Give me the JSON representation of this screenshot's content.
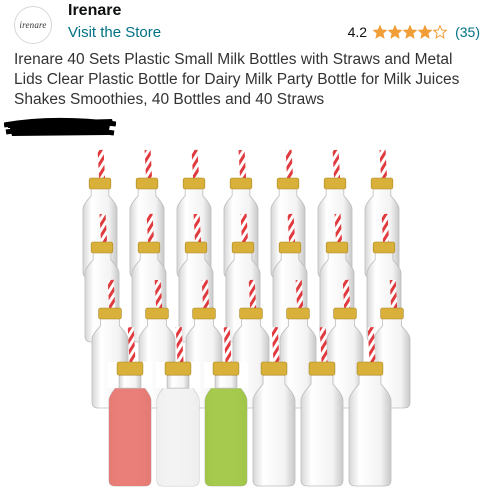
{
  "store": {
    "logo_text": "irenare",
    "brand_name": "Irenare",
    "visit_label": "Visit the Store"
  },
  "rating": {
    "value": "4.2",
    "stars_out_of_5": 4.2,
    "count": "(35)",
    "star_color": "#f19e39"
  },
  "product": {
    "title": "Irenare 40 Sets Plastic Small Milk Bottles with Straws and Metal Lids Clear Plastic Bottle for Dairy Milk Party Bottle for Milk Juices Shakes Smoothies, 40 Bottles and 40 Straws"
  },
  "image": {
    "description_icon": "milk-bottles-product-photo",
    "bottle_rows": 4,
    "bottles_per_row": 7,
    "front_row_fills": [
      "#e8706a",
      "#f2f2f2",
      "#9cc43a",
      "clear",
      "clear",
      "clear",
      "clear"
    ],
    "lid_color": "#d9b13a",
    "straw_color": "#e0393e"
  }
}
